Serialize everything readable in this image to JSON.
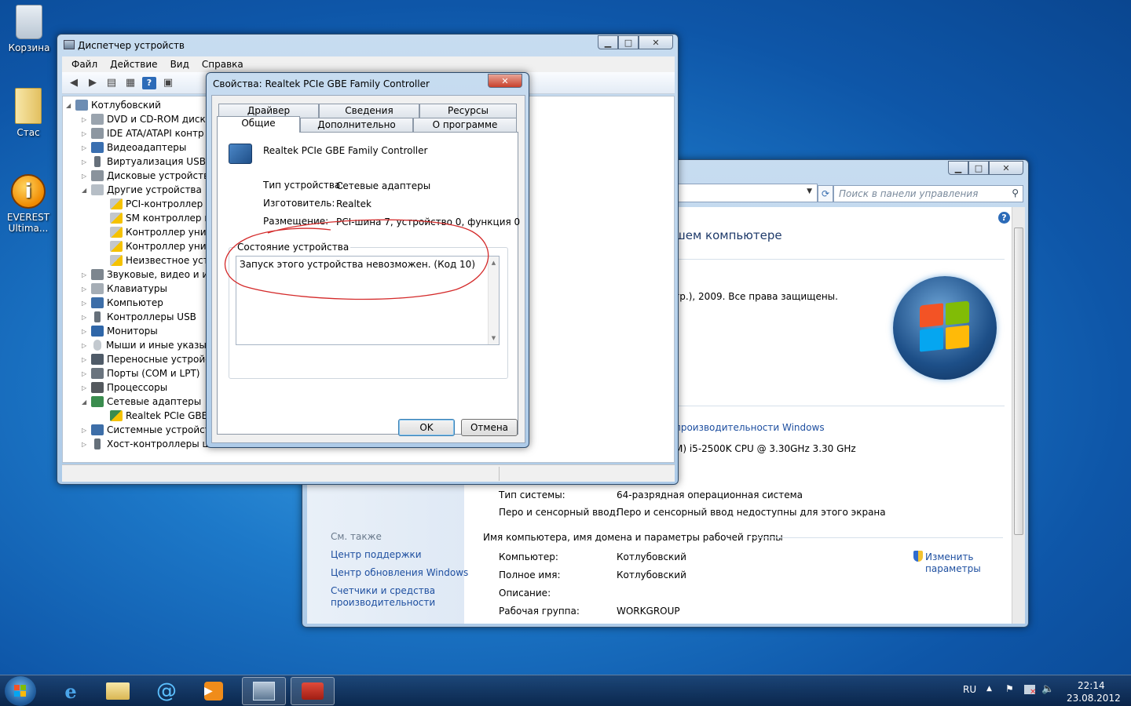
{
  "desktop": {
    "icons": [
      {
        "label": "Корзина"
      },
      {
        "label": "Стас"
      },
      {
        "label": "EVEREST Ultima..."
      }
    ]
  },
  "device_manager": {
    "title": "Диспетчер устройств",
    "menu": [
      "Файл",
      "Действие",
      "Вид",
      "Справка"
    ],
    "tree": [
      "Котлубовский",
      "DVD и CD-ROM диско",
      "IDE ATA/ATAPI контр",
      "Видеоадаптеры",
      "Виртуализация USB",
      "Дисковые устройства",
      "Другие устройства",
      "PCI-контроллер S",
      "SM контроллер ш",
      "Контроллер униве",
      "Контроллер униве",
      "Неизвестное устр",
      "Звуковые, видео и игр",
      "Клавиатуры",
      "Компьютер",
      "Контроллеры USB",
      "Мониторы",
      "Мыши и иные указы",
      "Переносные устройс",
      "Порты (COM и LPT)",
      "Процессоры",
      "Сетевые адаптеры",
      "Realtek PCIe GBE F",
      "Системные устройст",
      "Хост-контроллеры ш"
    ]
  },
  "system_window": {
    "search_placeholder": "Поиск в панели управления",
    "heading": "шем компьютере",
    "copyright": "гр.), 2009. Все права защищены.",
    "perf_link": "производительности Windows",
    "cpu": "M) i5-2500K CPU @ 3.30GHz   3.30 GHz",
    "rows": [
      {
        "label": "Тип системы:",
        "value": "64-разрядная операционная система"
      },
      {
        "label": "Перо и сенсорный ввод:",
        "value": "Перо и сенсорный ввод недоступны для этого экрана"
      }
    ],
    "section": "Имя компьютера, имя домена и параметры рабочей группы",
    "comp_rows": [
      {
        "label": "Компьютер:",
        "value": "Котлубовский"
      },
      {
        "label": "Полное имя:",
        "value": "Котлубовский"
      },
      {
        "label": "Описание:",
        "value": ""
      },
      {
        "label": "Рабочая группа:",
        "value": "WORKGROUP"
      }
    ],
    "change_link_1": "Изменить",
    "change_link_2": "параметры",
    "see_also": "См. также",
    "left_links": [
      "Центр поддержки",
      "Центр обновления Windows",
      "Счетчики и средства",
      "производительности"
    ]
  },
  "props_dialog": {
    "title": "Свойства: Realtek PCIe GBE Family Controller",
    "tabs_back": [
      "Драйвер",
      "Сведения",
      "Ресурсы"
    ],
    "tabs_front": [
      "Общие",
      "Дополнительно",
      "О программе"
    ],
    "device_name": "Realtek PCIe GBE Family Controller",
    "type_label": "Тип устройства:",
    "type_value": "Сетевые адаптеры",
    "mfr_label": "Изготовитель:",
    "mfr_value": "Realtek",
    "loc_label": "Размещение:",
    "loc_value": "PCI-шина 7, устройство 0, функция 0",
    "status_group": "Состояние устройства",
    "status_text": "Запуск этого устройства невозможен. (Код 10)",
    "ok": "OK",
    "cancel": "Отмена"
  },
  "taskbar": {
    "lang": "RU",
    "time": "22:14",
    "date": "23.08.2012"
  }
}
